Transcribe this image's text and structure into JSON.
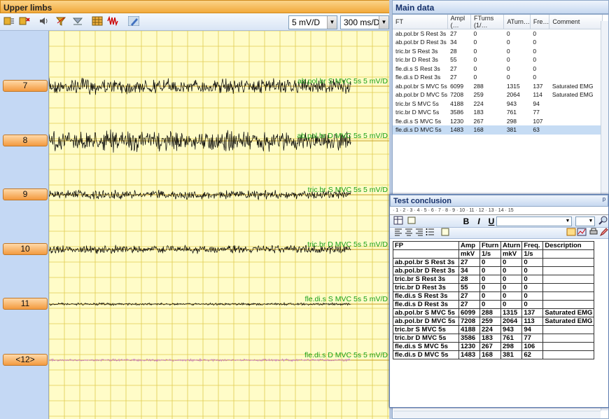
{
  "left_panel": {
    "title": "Upper limbs",
    "sensitivity": "5 mV/D",
    "sweep": "300 ms/D"
  },
  "toolbar_icons": [
    "channels-icon",
    "channels-remove-icon",
    "speaker-icon",
    "filter-icon",
    "filter-off-icon",
    "grid-icon",
    "artifact-icon",
    "marker-pen-icon"
  ],
  "channels": [
    {
      "label": "7",
      "trace_label": "ab.pol.br S  MVC 5s  5 mV/D",
      "color": "#000000",
      "amp": 0.75
    },
    {
      "label": "8",
      "trace_label": "ab.pol.br D  MVC 5s  5 mV/D",
      "color": "#000000",
      "amp": 1.0
    },
    {
      "label": "9",
      "trace_label": "tric.br S  MVC 5s  5 mV/D",
      "color": "#000000",
      "amp": 0.45
    },
    {
      "label": "10",
      "trace_label": "tric.br D  MVC 5s  5 mV/D",
      "color": "#000000",
      "amp": 0.4
    },
    {
      "label": "11",
      "trace_label": "fle.di.s S  MVC 5s  5 mV/D",
      "color": "#000000",
      "amp": 0.12
    },
    {
      "label": "<12>",
      "trace_label": "fle.di.s D  MVC 5s  5 mV/D",
      "color": "#c878c8",
      "amp": 0.12
    }
  ],
  "main_data": {
    "title": "Main data",
    "columns": [
      "FT",
      "Ampl (…",
      "FTurns (1/…",
      "ATurn…",
      "Fre…",
      "Comment"
    ],
    "rows": [
      [
        "ab.pol.br S  Rest 3s",
        "27",
        "0",
        "0",
        "0",
        ""
      ],
      [
        "ab.pol.br D  Rest 3s",
        "34",
        "0",
        "0",
        "0",
        ""
      ],
      [
        "tric.br S  Rest 3s",
        "28",
        "0",
        "0",
        "0",
        ""
      ],
      [
        "tric.br D  Rest 3s",
        "55",
        "0",
        "0",
        "0",
        ""
      ],
      [
        "fle.di.s S  Rest 3s",
        "27",
        "0",
        "0",
        "0",
        ""
      ],
      [
        "fle.di.s D  Rest 3s",
        "27",
        "0",
        "0",
        "0",
        ""
      ],
      [
        "ab.pol.br S  MVC 5s",
        "6099",
        "288",
        "1315",
        "137",
        "Saturated EMG"
      ],
      [
        "ab.pol.br D  MVC 5s",
        "7208",
        "259",
        "2064",
        "114",
        "Saturated EMG"
      ],
      [
        "tric.br S  MVC 5s",
        "4188",
        "224",
        "943",
        "94",
        ""
      ],
      [
        "tric.br D  MVC 5s",
        "3586",
        "183",
        "761",
        "77",
        ""
      ],
      [
        "fle.di.s S  MVC 5s",
        "1230",
        "267",
        "298",
        "107",
        ""
      ],
      [
        "fle.di.s D  MVC 5s",
        "1483",
        "168",
        "381",
        "63",
        ""
      ]
    ],
    "selected_index": 11
  },
  "test_conclusion": {
    "title": "Test conclusion",
    "pin": "ᵖ",
    "ruler": "· 1 · 2 · 3 · 4 · 5 · 6 · 7 · 8 · 9 · 10 · 11 · 12 · 13 · 14 · 15",
    "format_buttons": {
      "bold": "B",
      "italic": "I",
      "underline": "U"
    },
    "header1": [
      "FP",
      "Amp",
      "Fturn",
      "Aturn",
      "Freq.",
      "Description"
    ],
    "header2": [
      "",
      "mkV",
      "1/s",
      "mkV",
      "1/s",
      ""
    ],
    "rows": [
      [
        "ab.pol.br S  Rest 3s",
        "27",
        "0",
        "0",
        "0",
        ""
      ],
      [
        "ab.pol.br D  Rest 3s",
        "34",
        "0",
        "0",
        "0",
        ""
      ],
      [
        "tric.br S  Rest 3s",
        "28",
        "0",
        "0",
        "0",
        ""
      ],
      [
        "tric.br D  Rest 3s",
        "55",
        "0",
        "0",
        "0",
        ""
      ],
      [
        "fle.di.s S  Rest 3s",
        "27",
        "0",
        "0",
        "0",
        ""
      ],
      [
        "fle.di.s D  Rest 3s",
        "27",
        "0",
        "0",
        "0",
        ""
      ],
      [
        "ab.pol.br S  MVC 5s",
        "6099",
        "288",
        "1315",
        "137",
        "Saturated EMG"
      ],
      [
        "ab.pol.br D  MVC 5s",
        "7208",
        "259",
        "2064",
        "113",
        "Saturated EMG"
      ],
      [
        "tric.br S  MVC 5s",
        "4188",
        "224",
        "943",
        "94",
        ""
      ],
      [
        "tric.br D  MVC 5s",
        "3586",
        "183",
        "761",
        "77",
        ""
      ],
      [
        "fle.di.s S  MVC 5s",
        "1230",
        "267",
        "298",
        "106",
        ""
      ],
      [
        "fle.di.s D  MVC 5s",
        "1483",
        "168",
        "381",
        "62",
        ""
      ]
    ]
  }
}
